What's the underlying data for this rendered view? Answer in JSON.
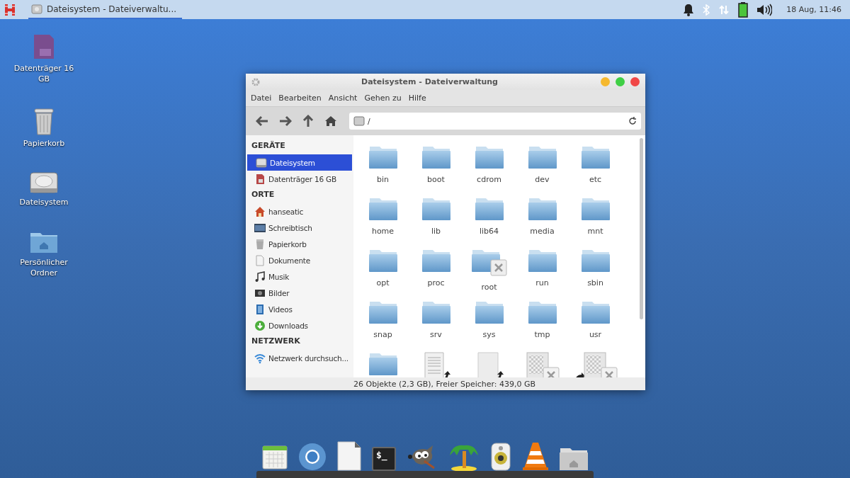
{
  "taskbar": {
    "tasks": [
      {
        "title": "Dateisystem - Dateiverwaltu...",
        "selected": true
      }
    ],
    "clock": "18 Aug, 11:46"
  },
  "desktop_icons": [
    {
      "label": "Datenträger 16 GB",
      "kind": "sd"
    },
    {
      "label": "Papierkorb",
      "kind": "trash"
    },
    {
      "label": "Dateisystem",
      "kind": "drive"
    },
    {
      "label": "Persönlicher Ordner",
      "kind": "home"
    }
  ],
  "window": {
    "title": "Dateisystem - Dateiverwaltung",
    "menu": [
      "Datei",
      "Bearbeiten",
      "Ansicht",
      "Gehen zu",
      "Hilfe"
    ],
    "path": "/",
    "sidebar": [
      {
        "heading": "GERÄTE",
        "items": [
          {
            "label": "Dateisystem",
            "kind": "drive",
            "selected": true
          },
          {
            "label": "Datenträger 16 GB",
            "kind": "sd",
            "selected": false
          }
        ]
      },
      {
        "heading": "ORTE",
        "items": [
          {
            "label": "hanseatic",
            "kind": "home",
            "selected": false
          },
          {
            "label": "Schreibtisch",
            "kind": "desktop",
            "selected": false
          },
          {
            "label": "Papierkorb",
            "kind": "trash",
            "selected": false
          },
          {
            "label": "Dokumente",
            "kind": "doc",
            "selected": false
          },
          {
            "label": "Musik",
            "kind": "music",
            "selected": false
          },
          {
            "label": "Bilder",
            "kind": "pictures",
            "selected": false
          },
          {
            "label": "Videos",
            "kind": "videos",
            "selected": false
          },
          {
            "label": "Downloads",
            "kind": "downloads",
            "selected": false
          }
        ]
      },
      {
        "heading": "NETZWERK",
        "items": [
          {
            "label": "Netzwerk durchsuch...",
            "kind": "network",
            "selected": false
          }
        ]
      }
    ],
    "files": [
      {
        "name": "bin",
        "kind": "folder"
      },
      {
        "name": "boot",
        "kind": "folder"
      },
      {
        "name": "cdrom",
        "kind": "folder"
      },
      {
        "name": "dev",
        "kind": "folder"
      },
      {
        "name": "etc",
        "kind": "folder"
      },
      {
        "name": "home",
        "kind": "folder"
      },
      {
        "name": "lib",
        "kind": "folder"
      },
      {
        "name": "lib64",
        "kind": "folder"
      },
      {
        "name": "media",
        "kind": "folder"
      },
      {
        "name": "mnt",
        "kind": "folder"
      },
      {
        "name": "opt",
        "kind": "folder"
      },
      {
        "name": "proc",
        "kind": "folder"
      },
      {
        "name": "root",
        "kind": "locked-folder"
      },
      {
        "name": "run",
        "kind": "folder"
      },
      {
        "name": "sbin",
        "kind": "folder"
      },
      {
        "name": "snap",
        "kind": "folder"
      },
      {
        "name": "srv",
        "kind": "folder"
      },
      {
        "name": "sys",
        "kind": "folder"
      },
      {
        "name": "tmp",
        "kind": "folder"
      },
      {
        "name": "usr",
        "kind": "folder"
      },
      {
        "kind": "folder"
      },
      {
        "kind": "text-link"
      },
      {
        "kind": "file-link"
      },
      {
        "kind": "broken-link"
      },
      {
        "kind": "broken-link-left"
      }
    ],
    "status": "26 Objekte (2,3 GB), Freier Speicher: 439,0 GB"
  },
  "dock": [
    {
      "kind": "calendar"
    },
    {
      "kind": "browser"
    },
    {
      "kind": "document"
    },
    {
      "kind": "terminal",
      "glyph": "$_"
    },
    {
      "kind": "mascot"
    },
    {
      "kind": "palm"
    },
    {
      "kind": "speaker"
    },
    {
      "kind": "cone"
    },
    {
      "kind": "home-folder"
    }
  ]
}
